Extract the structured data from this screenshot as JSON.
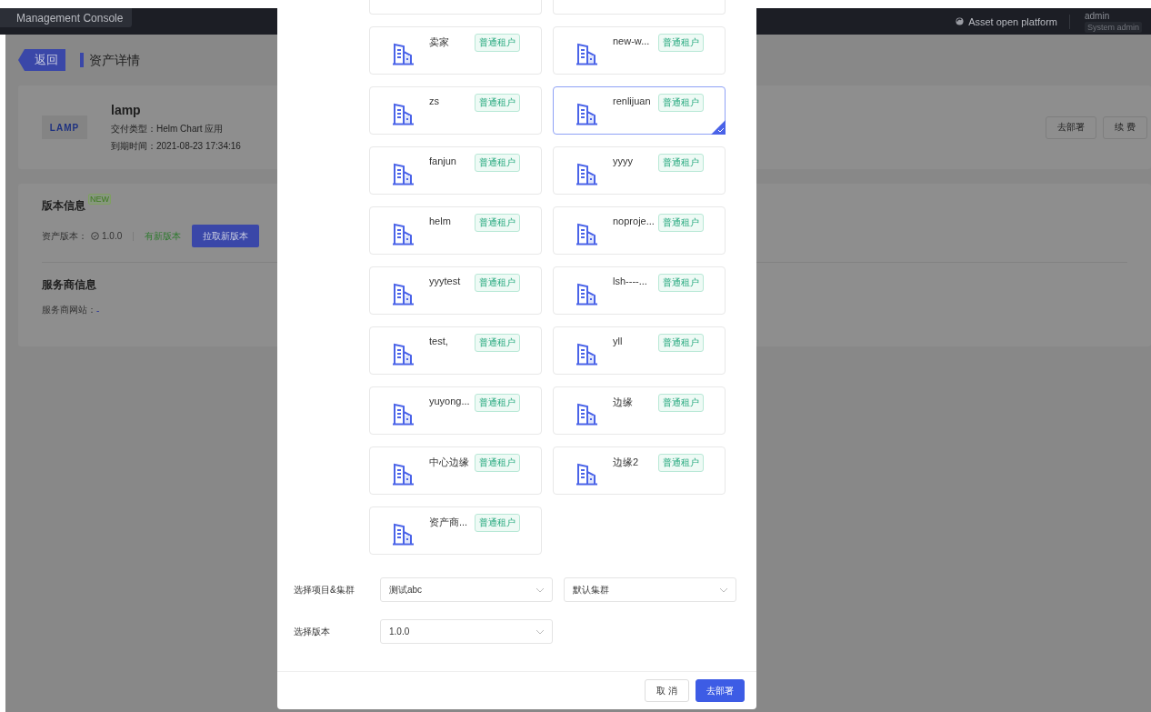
{
  "header": {
    "console_tab": "Management Console",
    "platform_link": "Asset open platform",
    "user_name": "admin",
    "user_role": "System admin"
  },
  "page": {
    "back_button": "返回",
    "title": "资产详情",
    "asset": {
      "logo_text": "LAMP",
      "name": "lamp",
      "fields": [
        {
          "label": "交付类型：",
          "value": "Helm Chart 应用"
        },
        {
          "label": "到期时间：",
          "value": "2021-08-23 17:34:16"
        }
      ],
      "actions": [
        "去部署",
        "续 费"
      ]
    },
    "version": {
      "title": "版本信息",
      "badge": "NEW",
      "label": "资产版本：",
      "value": "1.0.0",
      "notice": "有新版本",
      "button": "拉取新版本"
    },
    "provider": {
      "title": "服务商信息",
      "label": "服务商网站：",
      "value": "-"
    }
  },
  "modal": {
    "tenants": [
      {
        "name": "卖家",
        "tag": "普通租户",
        "selected": false
      },
      {
        "name": "new-w...",
        "tag": "普通租户",
        "selected": false
      },
      {
        "name": "zs",
        "tag": "普通租户",
        "selected": false
      },
      {
        "name": "renlijuan",
        "tag": "普通租户",
        "selected": true
      },
      {
        "name": "fanjun",
        "tag": "普通租户",
        "selected": false
      },
      {
        "name": "yyyy",
        "tag": "普通租户",
        "selected": false
      },
      {
        "name": "helm",
        "tag": "普通租户",
        "selected": false
      },
      {
        "name": "noproje...",
        "tag": "普通租户",
        "selected": false
      },
      {
        "name": "yyytest",
        "tag": "普通租户",
        "selected": false
      },
      {
        "name": "lsh----...",
        "tag": "普通租户",
        "selected": false
      },
      {
        "name": "test,",
        "tag": "普通租户",
        "selected": false
      },
      {
        "name": "yll",
        "tag": "普通租户",
        "selected": false
      },
      {
        "name": "yuyong...",
        "tag": "普通租户",
        "selected": false
      },
      {
        "name": "边缘",
        "tag": "普通租户",
        "selected": false
      },
      {
        "name": "中心边缘",
        "tag": "普通租户",
        "selected": false
      },
      {
        "name": "边缘2",
        "tag": "普通租户",
        "selected": false
      },
      {
        "name": "资产商...",
        "tag": "普通租户",
        "selected": false
      }
    ],
    "form": [
      {
        "label": "选择项目&集群",
        "selects": [
          "测试abc",
          "默认集群"
        ]
      },
      {
        "label": "选择版本",
        "selects": [
          "1.0.0"
        ]
      }
    ],
    "cancel_button": "取 消",
    "confirm_button": "去部署"
  }
}
